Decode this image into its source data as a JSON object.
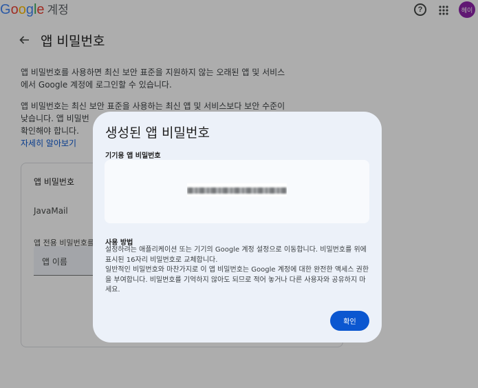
{
  "header": {
    "logo_text": "Google",
    "logo_suffix": "계정",
    "help_icon": "help-icon",
    "apps_icon": "apps-grid-icon",
    "avatar_label": "헤이",
    "avatar_color": "#8e24aa"
  },
  "page": {
    "title": "앱 비밀번호",
    "para1_line1": "앱 비밀번호를 사용하면 최신 보안 표준을 지원하지 않는 오래된 앱 및 서비스",
    "para1_line2": "에서 Google 계정에 로그인할 수 있습니다.",
    "para2_line1": "앱 비밀번호는 최신 보안 표준을 사용하는 최신 앱 및 서비스보다 보안 수준이",
    "para2_line2": "낮습니다. 앱 비밀번",
    "para2_line3": "확인해야 합니다.",
    "learn_more": "자세히 알아보기"
  },
  "card": {
    "title": "앱 비밀번호",
    "app_name": "JavaMail",
    "new_app_label": "앱 전용 비밀번호를",
    "app_name_placeholder": "앱 이름"
  },
  "dialog": {
    "title": "생성된 앱 비밀번호",
    "subtitle": "기기용 앱 비밀번호",
    "usage_title": "사용 방법",
    "usage_p1": "설정하려는 애플리케이션 또는 기기의 Google 계정 설정으로 이동합니다. 비밀번호를 위에 표시된 16자리 비밀번호로 교체합니다.",
    "usage_p2": "일반적인 비밀번호와 마찬가지로 이 앱 비밀번호는 Google 계정에 대한 완전한 액세스 권한을 부여합니다. 비밀번호를 기억하지 않아도 되므로 적어 놓거나 다른 사용자와 공유하지 마세요.",
    "confirm_button": "확인"
  },
  "colors": {
    "accent": "#0b57d0",
    "dialog_bg": "#ecf1f9"
  }
}
